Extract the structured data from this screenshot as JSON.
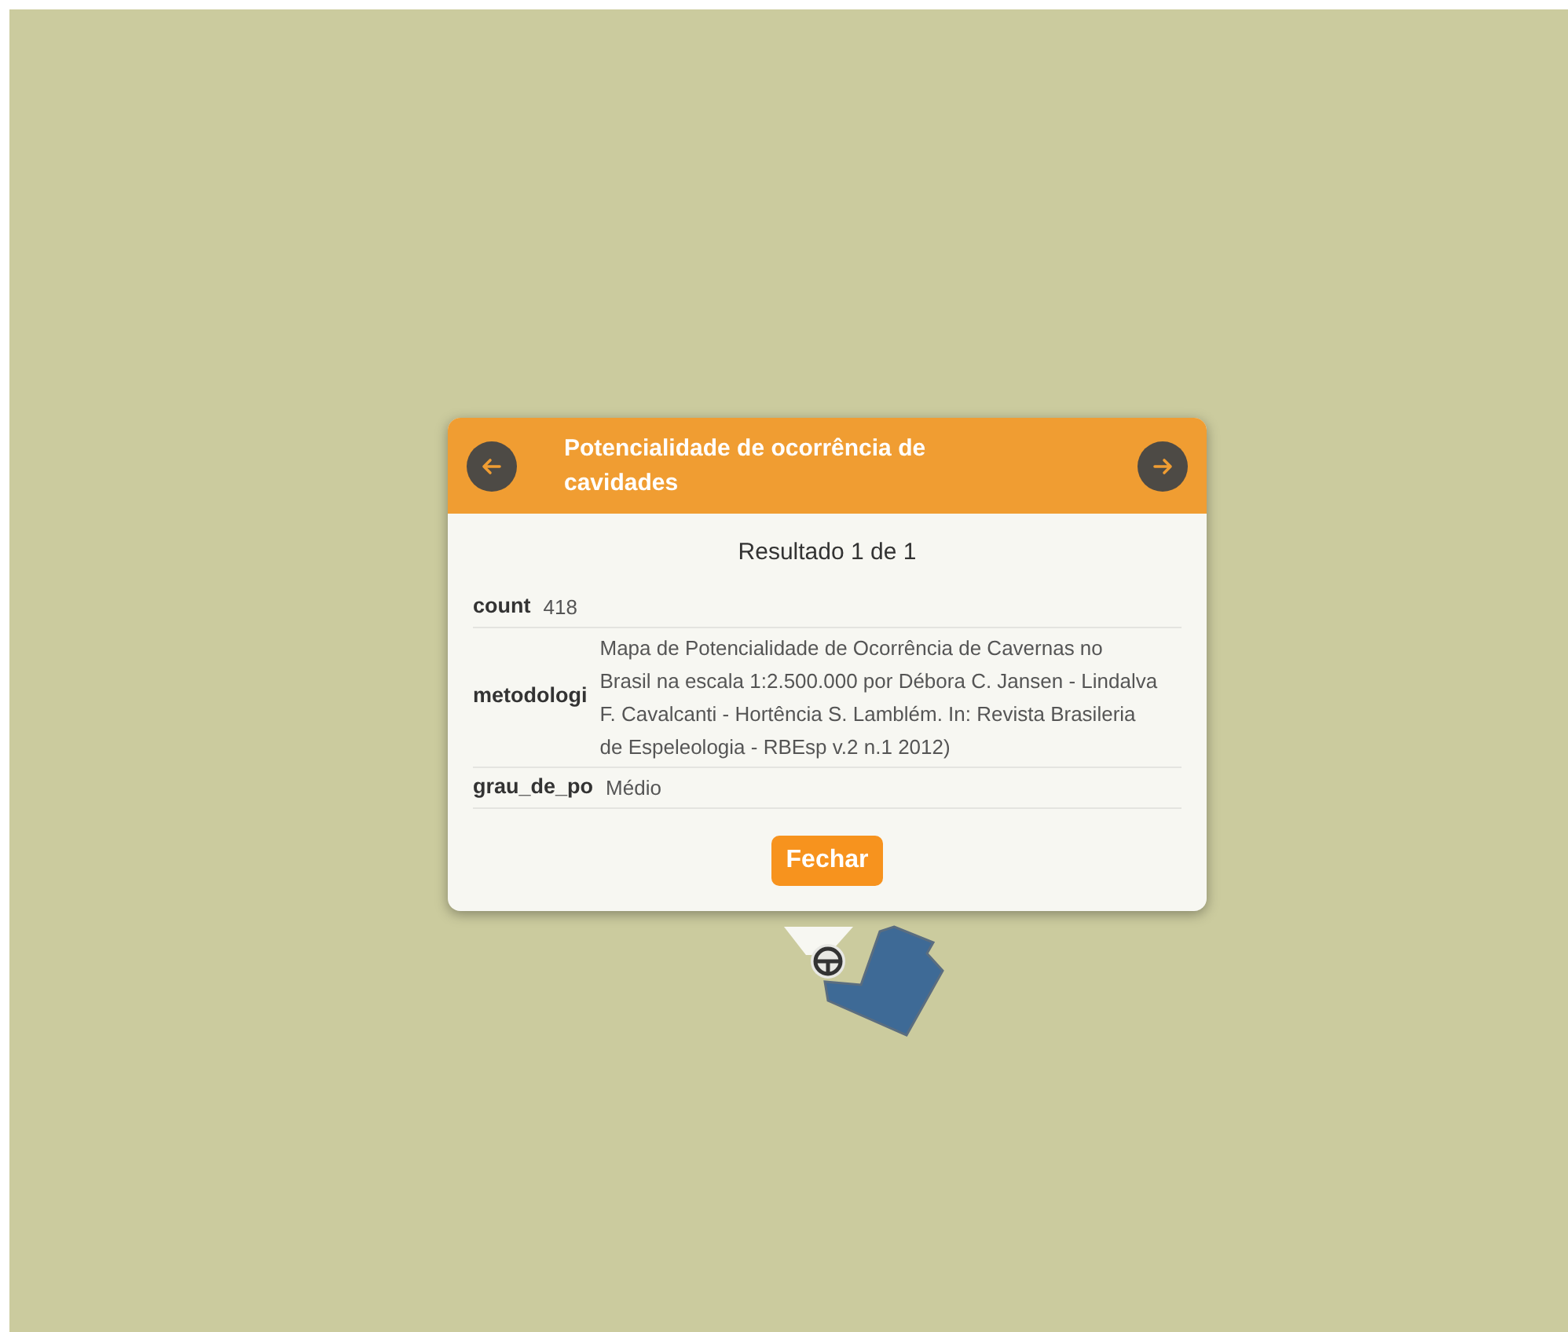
{
  "popup": {
    "title": "Potencialidade de ocorrência de cavidades",
    "result": "Resultado 1 de 1",
    "fields": [
      {
        "label": "count",
        "value": "418"
      },
      {
        "label": "metodologi",
        "value": "Mapa de Potencialidade de Ocorrência de Cavernas no Brasil na escala 1:2.500.000 por Débora C. Jansen - Lindalva F. Cavalcanti - Hortência S. Lamblém. In: Revista Brasileria de Espeleologia - RBEsp v.2 n.1 2012)"
      },
      {
        "label": "grau_de_po",
        "value": "Médio"
      }
    ],
    "close_button": "Fechar"
  }
}
